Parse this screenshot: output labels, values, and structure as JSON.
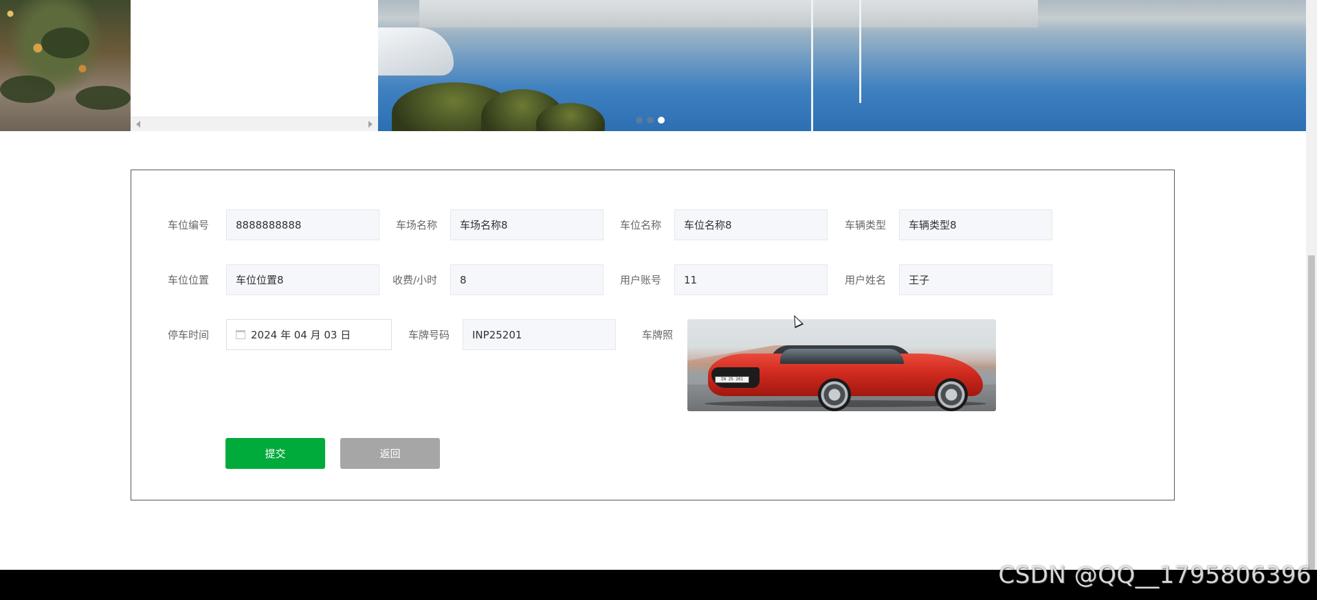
{
  "banner": {
    "slides": [
      {
        "id": "slide-1",
        "active": false
      },
      {
        "id": "slide-2",
        "active": false
      },
      {
        "id": "slide-3",
        "active": true
      }
    ]
  },
  "form": {
    "fields": {
      "space_no": {
        "label": "车位编号",
        "value": "8888888888"
      },
      "lot_name": {
        "label": "车场名称",
        "value": "车场名称8"
      },
      "space_name": {
        "label": "车位名称",
        "value": "车位名称8"
      },
      "vehicle_type": {
        "label": "车辆类型",
        "value": "车辆类型8"
      },
      "space_location": {
        "label": "车位位置",
        "value": "车位位置8"
      },
      "fee_per_hour": {
        "label": "收费/小时",
        "value": "8"
      },
      "user_account": {
        "label": "用户账号",
        "value": "11"
      },
      "user_name": {
        "label": "用户姓名",
        "value": "王子"
      },
      "park_time": {
        "label": "停车时间",
        "value": "2024 年 04 月 03 日"
      },
      "plate_no": {
        "label": "车牌号码",
        "value": "INP25201"
      },
      "plate_photo": {
        "label": "车牌照"
      }
    },
    "photo_plate_text": "IN 25 201",
    "buttons": {
      "submit": "提交",
      "back": "返回"
    }
  },
  "watermark": "CSDN @QQ__1795806396",
  "colors": {
    "submit": "#00ab3c",
    "back": "#a6a6a6",
    "input_bg": "#f5f7fa",
    "footer": "#000000"
  }
}
